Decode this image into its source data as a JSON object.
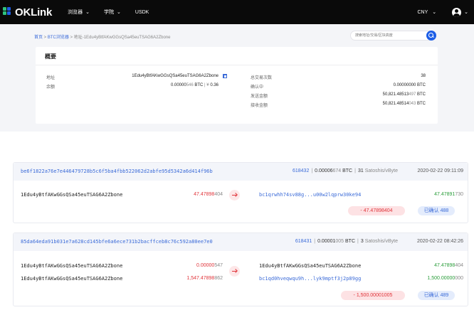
{
  "header": {
    "logo_text": "OKLink",
    "nav": [
      {
        "label": "浏览器",
        "has_dropdown": true
      },
      {
        "label": "学院",
        "has_dropdown": true
      },
      {
        "label": "USDK",
        "has_dropdown": false
      }
    ],
    "currency": "CNY",
    "dropdown_glyph": "⌄",
    "logo_colors": [
      "#2ec27e",
      "#1d5ee6",
      "#2ec27e",
      "#1d5ee6"
    ]
  },
  "breadcrumb": {
    "home": "首页",
    "sep1": " > ",
    "explorer": "BTC浏览器",
    "sep2": " > ",
    "current": "地址-1Edu4yBtfAKwGGsQSa45euTSAG6A2Zbone"
  },
  "search": {
    "placeholder": "搜索地址/交易/区块高度"
  },
  "overview": {
    "title": "概要",
    "address_label": "地址",
    "address_value": "1Edu4yBtfAKwGGsQSa45euTSAG6A2Zbone",
    "balance_label": "余额",
    "balance_btc_strong": "0.00000",
    "balance_btc_muted": "546",
    "balance_btc_unit": " BTC",
    "balance_sep": "  |  ",
    "balance_fiat_symbol": "¥ ",
    "balance_fiat": "0.36",
    "total_tx_label": "总交易次数",
    "total_tx_value": "38",
    "unconfirmed_label": "确认中",
    "unconfirmed_value": "0.00000000 BTC",
    "sent_label": "发送金额",
    "sent_strong": "50,821.48513",
    "sent_muted": "497",
    "sent_unit": " BTC",
    "received_label": "接收金额",
    "received_strong": "50,821.48514",
    "received_muted": "043",
    "received_unit": " BTC"
  },
  "transactions": [
    {
      "hash": "be6f1822a76e7e446479728b5c6f5ba4fbb522062d2abfe95d5342a6d414f96b",
      "block": "618432",
      "sep": "|",
      "fee_strong": "0.00006",
      "fee_muted": "674",
      "fee_unit": " BTC",
      "sat_rate_strong": "31",
      "sat_rate_unit": " Satoshis/vByte",
      "time": "2020-02-22 09:11:09",
      "inputs": [
        {
          "address": "1Edu4yBtfAKwGGsQSa45euTSAG6A2Zbone",
          "amount_strong": "47.47898",
          "amount_muted": "404"
        }
      ],
      "outputs": [
        {
          "address": "bc1qrwhh74sv88g...u00w2lqprw30ke94",
          "amount_strong": "47.47891",
          "amount_muted": "730"
        }
      ],
      "net_change": "- 47.47898404",
      "confirmations": "已确认 488"
    },
    {
      "hash": "85da64eda91b031e7a628cd145bfe6a6ece731b2bacffceb8c76c592a80ee7e0",
      "block": "618431",
      "sep": "|",
      "fee_strong": "0.00001",
      "fee_muted": "005",
      "fee_unit": " BTC",
      "sat_rate_strong": "3",
      "sat_rate_unit": " Satoshis/vByte",
      "time": "2020-02-22 08:42:26",
      "inputs": [
        {
          "address": "1Edu4yBtfAKwGGsQSa45euTSAG6A2Zbone",
          "amount_strong": "0.00000",
          "amount_muted": "547"
        },
        {
          "address": "1Edu4yBtfAKwGGsQSa45euTSAG6A2Zbone",
          "amount_strong": "1,547.47898",
          "amount_muted": "862"
        }
      ],
      "outputs": [
        {
          "address": "1Edu4yBtfAKwGGsQSa45euTSAG6A2Zbone",
          "amount_strong": "47.47898",
          "amount_muted": "404"
        },
        {
          "address": "bc1qd0hveqwqu9h...lyk9mptf3j2p89gg",
          "amount_strong": "1,500.00000",
          "amount_muted": "000"
        }
      ],
      "net_change": "- 1,500.00001005",
      "confirmations": "已确认 489"
    }
  ]
}
